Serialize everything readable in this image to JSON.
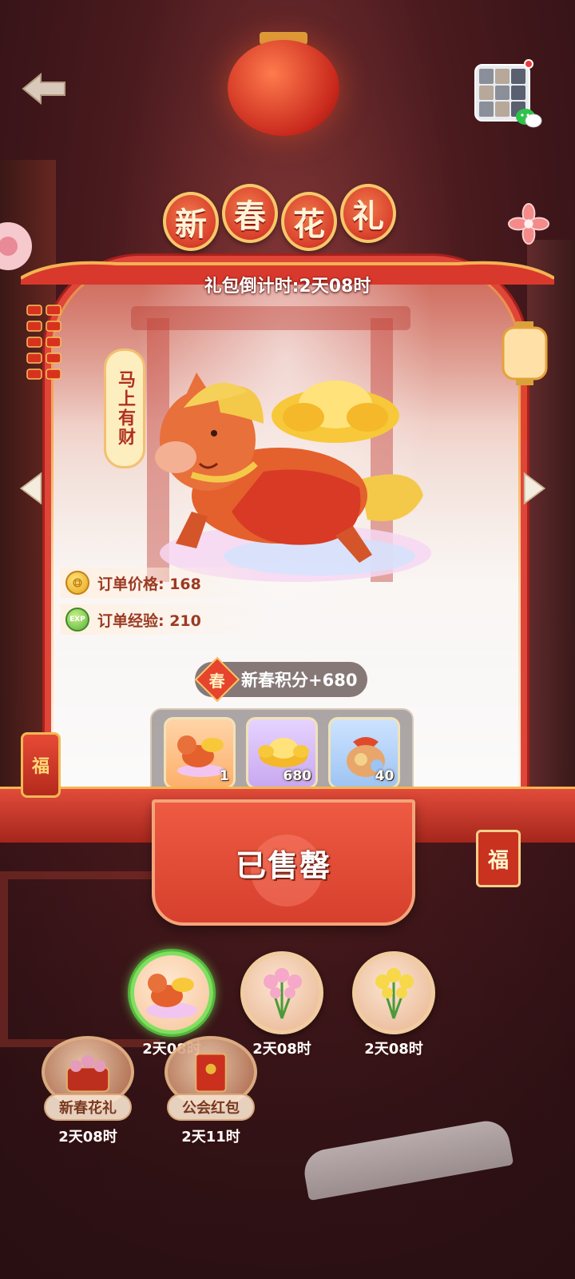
{
  "header": {
    "back_icon": "back-arrow-icon",
    "close_icon": "flower-close-icon"
  },
  "colors": {
    "frame_red": "#e0453a",
    "gold": "#f7c86a",
    "active_green": "#7fe060"
  },
  "gift": {
    "title_chars": [
      "新",
      "春",
      "花",
      "礼"
    ],
    "countdown": "礼包倒计时:2天08时",
    "vertical_tag": "马上有财",
    "price": "订单价格: 168",
    "exp": "订单经验: 210",
    "exp_badge": "EXP",
    "points_badge": "春",
    "points": "新春积分+680",
    "items": [
      {
        "icon": "horse-icon",
        "qty": "1"
      },
      {
        "icon": "gold-ingot-icon",
        "qty": "680"
      },
      {
        "icon": "money-bag-icon",
        "qty": "40"
      }
    ],
    "sold_label": "已售罄"
  },
  "decor": {
    "fu_left": "福",
    "fu_right": "福"
  },
  "gift_options": [
    {
      "icon": "horse-thumb-icon",
      "time": "2天08时",
      "active": true
    },
    {
      "icon": "pink-flowers-icon",
      "time": "2天08时",
      "active": false
    },
    {
      "icon": "yellow-flowers-icon",
      "time": "2天08时",
      "active": false
    }
  ],
  "tabs": [
    {
      "label": "新春花礼",
      "time": "2天08时",
      "icon": "flower-basket-icon"
    },
    {
      "label": "公会红包",
      "time": "2天11时",
      "icon": "red-envelope-icon"
    }
  ]
}
